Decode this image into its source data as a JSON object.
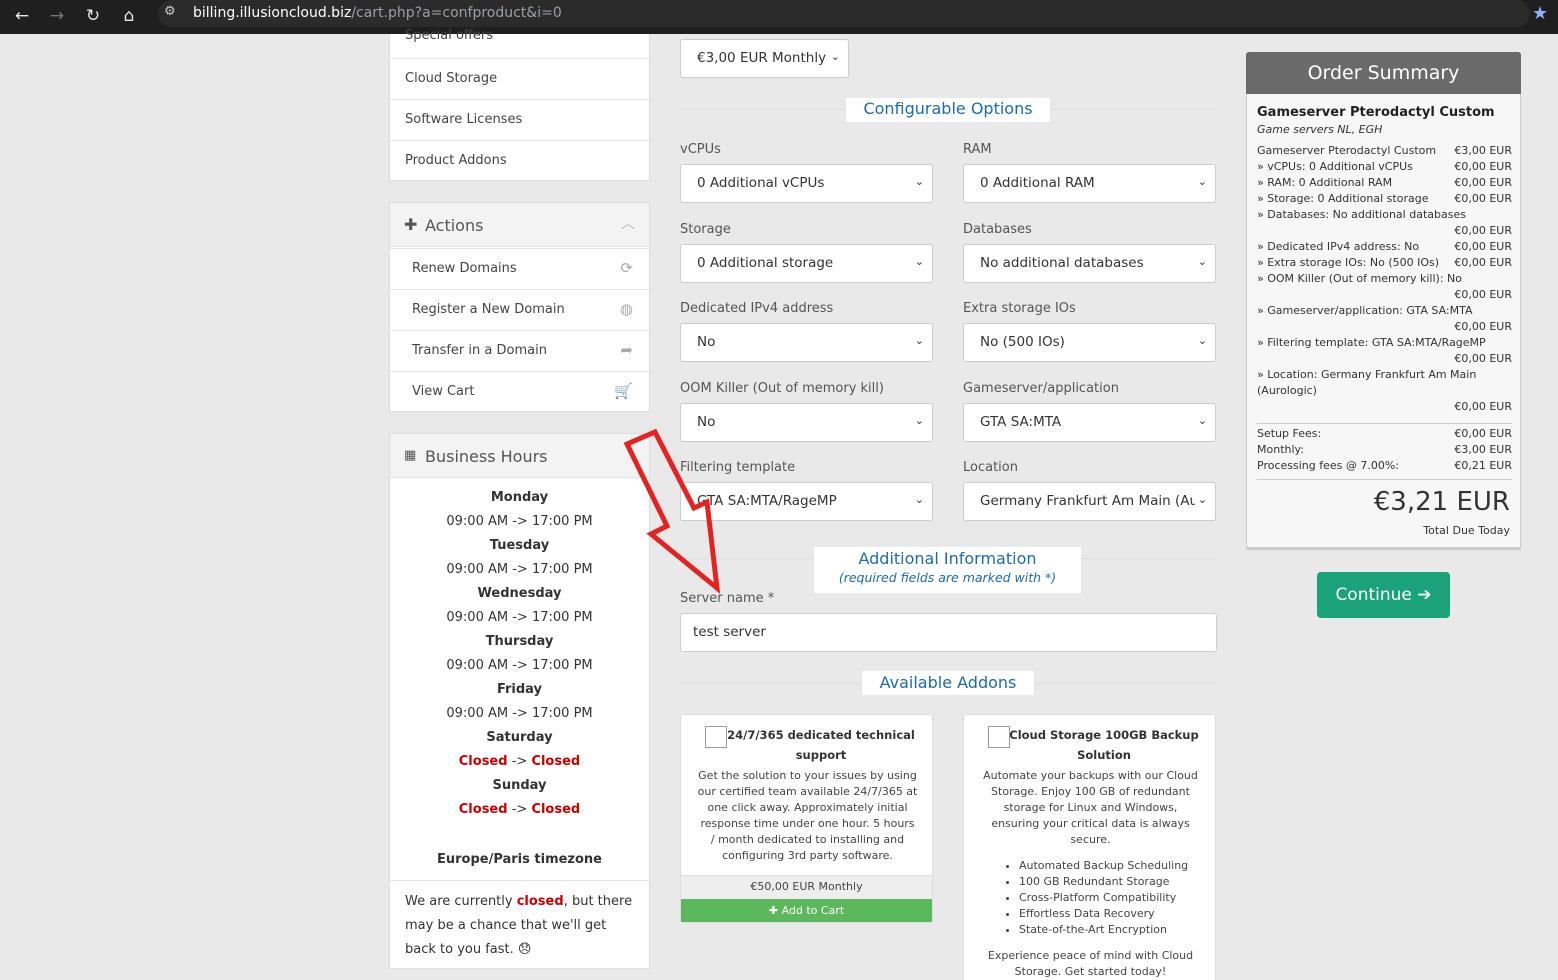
{
  "browser": {
    "url_host": "billing.illusioncloud.biz",
    "url_path": "/cart.php?a=confproduct&i=0"
  },
  "sidebar": {
    "categories": [
      {
        "label": "Special offers"
      },
      {
        "label": "Cloud Storage"
      },
      {
        "label": "Software Licenses"
      },
      {
        "label": "Product Addons"
      }
    ],
    "actions": {
      "title": "Actions",
      "items": [
        {
          "label": "Renew Domains",
          "icon": "refresh-icon"
        },
        {
          "label": "Register a New Domain",
          "icon": "globe-icon"
        },
        {
          "label": "Transfer in a Domain",
          "icon": "share-icon"
        },
        {
          "label": "View Cart",
          "icon": "cart-icon"
        }
      ]
    },
    "business_hours": {
      "title": "Business Hours",
      "days": [
        {
          "day": "Monday",
          "open": "09:00 AM",
          "sep": "->",
          "close": "17:00 PM"
        },
        {
          "day": "Tuesday",
          "open": "09:00 AM",
          "sep": "->",
          "close": "17:00 PM"
        },
        {
          "day": "Wednesday",
          "open": "09:00 AM",
          "sep": "->",
          "close": "17:00 PM"
        },
        {
          "day": "Thursday",
          "open": "09:00 AM",
          "sep": "->",
          "close": "17:00 PM"
        },
        {
          "day": "Friday",
          "open": "09:00 AM",
          "sep": "->",
          "close": "17:00 PM"
        },
        {
          "day": "Saturday",
          "open": "Closed",
          "sep": "->",
          "close": "Closed"
        },
        {
          "day": "Sunday",
          "open": "Closed",
          "sep": "->",
          "close": "Closed"
        }
      ],
      "timezone": "Europe/Paris timezone",
      "status_pre": "We are currently ",
      "status_word": "closed",
      "status_post": ", but there may be a chance that we'll get back to you fast. 😞"
    }
  },
  "main": {
    "billing_cycle": "€3,00 EUR Monthly",
    "configurable_title": "Configurable Options",
    "options": [
      {
        "label": "vCPUs",
        "value": "0 Additional vCPUs"
      },
      {
        "label": "RAM",
        "value": "0 Additional RAM"
      },
      {
        "label": "Storage",
        "value": "0 Additional storage"
      },
      {
        "label": "Databases",
        "value": "No additional databases"
      },
      {
        "label": "Dedicated IPv4 address",
        "value": "No"
      },
      {
        "label": "Extra storage IOs",
        "value": "No (500 IOs)"
      },
      {
        "label": "OOM Killer (Out of memory kill)",
        "value": "No"
      },
      {
        "label": "Gameserver/application",
        "value": "GTA SA:MTA"
      },
      {
        "label": "Filtering template",
        "value": "GTA SA:MTA/RageMP"
      },
      {
        "label": "Location",
        "value": "Germany Frankfurt Am Main (Au"
      }
    ],
    "additional_title": "Additional Information",
    "additional_sub": "(required fields are marked with *)",
    "server_name_label": "Server name *",
    "server_name_value": "test server",
    "addons_title": "Available Addons",
    "addons": [
      {
        "title_1": "24/7/365 dedicated technical",
        "title_2": "support",
        "desc": [
          "Get the solution to your issues by using",
          "our certified team available 24/7/365 at",
          "one click away. Approximately initial",
          "response time under one hour. 5 hours",
          "/ month dedicated to installing and",
          "configuring 3rd party software."
        ],
        "price": "€50,00 EUR Monthly",
        "button": "Add to Cart"
      },
      {
        "title_1": "Cloud Storage 100GB Backup",
        "title_2": "Solution",
        "desc": [
          "Automate your backups with our Cloud",
          "Storage. Enjoy 100 GB of redundant",
          "storage for Linux and Windows,",
          "ensuring your critical data is always",
          "secure."
        ],
        "features": [
          "Automated Backup Scheduling",
          "100 GB Redundant Storage",
          "Cross-Platform Compatibility",
          "Effortless Data Recovery",
          "State-of-the-Art Encryption"
        ],
        "footer": [
          "Experience peace of mind with Cloud",
          "Storage. Get started today!"
        ]
      }
    ]
  },
  "summary": {
    "title": "Order Summary",
    "product": "Gameserver Pterodactyl Custom",
    "group": "Game servers NL, EGH",
    "lines": [
      {
        "l": "Gameserver Pterodactyl Custom",
        "r": "€3,00 EUR"
      },
      {
        "l": " » vCPUs: 0 Additional vCPUs",
        "r": "€0,00 EUR"
      },
      {
        "l": " » RAM: 0 Additional RAM",
        "r": "€0,00 EUR"
      },
      {
        "l": " » Storage: 0 Additional storage",
        "r": "€0,00 EUR"
      },
      {
        "l": " » Databases: No additional databases",
        "r": ""
      },
      {
        "l": "",
        "r": "€0,00 EUR"
      },
      {
        "l": " » Dedicated IPv4 address: No",
        "r": "€0,00 EUR"
      },
      {
        "l": " » Extra storage IOs: No (500 IOs)",
        "r": "€0,00 EUR"
      },
      {
        "l": " » OOM Killer (Out of memory kill): No",
        "r": ""
      },
      {
        "l": "",
        "r": "€0,00 EUR"
      },
      {
        "l": " » Gameserver/application: GTA SA:MTA",
        "r": ""
      },
      {
        "l": "",
        "r": "€0,00 EUR"
      },
      {
        "l": " » Filtering template: GTA SA:MTA/RageMP",
        "r": ""
      },
      {
        "l": "",
        "r": "€0,00 EUR"
      },
      {
        "l": " » Location: Germany Frankfurt Am Main",
        "r": ""
      },
      {
        "l": "(Aurologic)",
        "r": ""
      },
      {
        "l": "",
        "r": "€0,00 EUR"
      }
    ],
    "setup_label": "Setup Fees:",
    "setup_value": "€0,00 EUR",
    "monthly_label": "Monthly:",
    "monthly_value": "€3,00 EUR",
    "fees_label": "Processing fees @ 7.00%:",
    "fees_value": "€0,21 EUR",
    "total": "€3,21 EUR",
    "total_label": "Total Due Today",
    "continue": "Continue"
  }
}
